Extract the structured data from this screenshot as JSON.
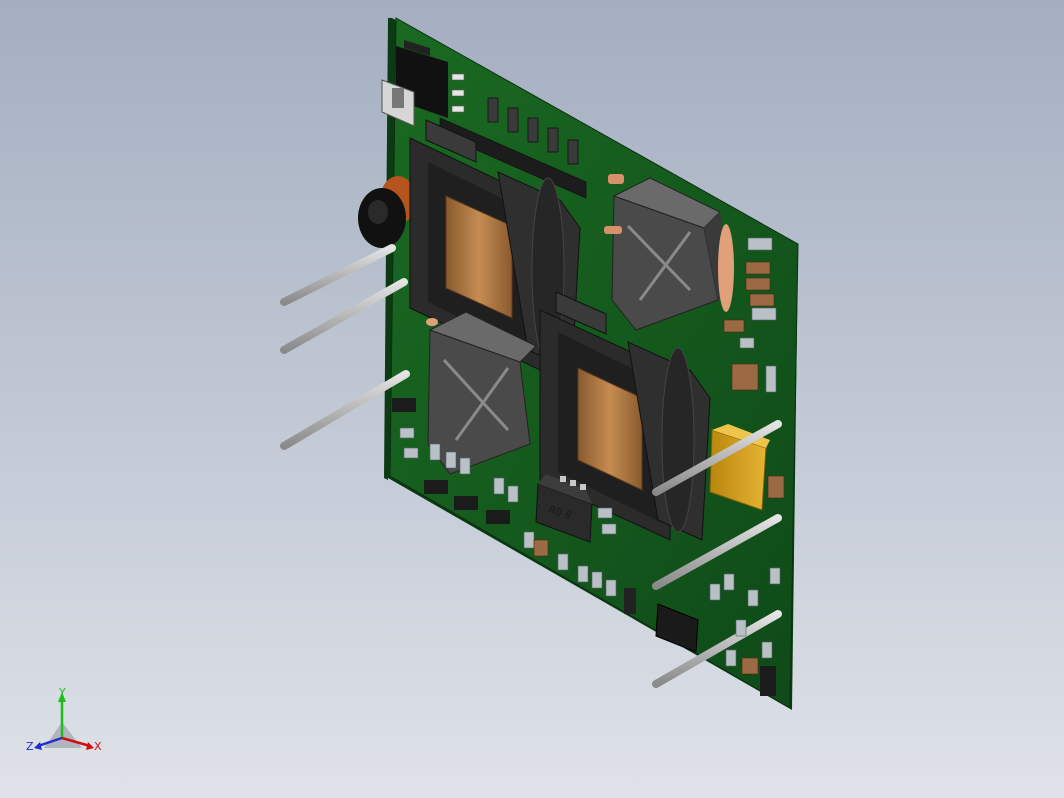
{
  "scene": {
    "background_top": "#a4aec0",
    "background_bottom": "#dfe2e8",
    "board_color": "#13521c",
    "board_edge_color": "#0c3a12",
    "transformer_body": "#2a2a2a",
    "copper_color": "#b07a45",
    "pin_color": "#c8c8c8",
    "capacitor_color": "#d9a21c",
    "chip_label": "R0-8"
  },
  "triad": {
    "y_label": "Y",
    "x_label": "X",
    "z_label": "Z",
    "y_color": "#1cbf1c",
    "x_color": "#d01010",
    "z_color": "#2030c8"
  }
}
